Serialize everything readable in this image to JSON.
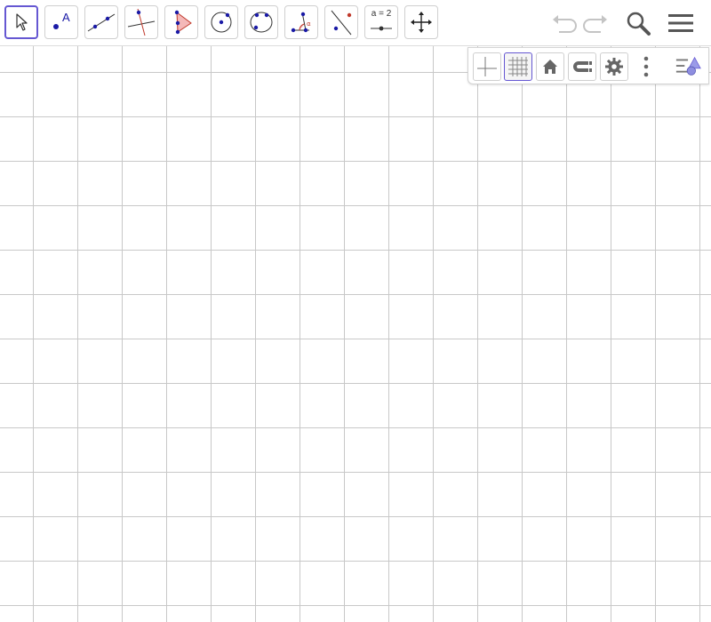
{
  "toolbar": {
    "tools": [
      {
        "name": "move-tool",
        "active": true
      },
      {
        "name": "point-tool"
      },
      {
        "name": "line-tool"
      },
      {
        "name": "perpendicular-line-tool"
      },
      {
        "name": "polygon-tool"
      },
      {
        "name": "circle-center-point-tool"
      },
      {
        "name": "circle-three-points-tool"
      },
      {
        "name": "angle-tool"
      },
      {
        "name": "reflect-about-line-tool"
      },
      {
        "name": "slider-tool",
        "label": "a = 2"
      },
      {
        "name": "move-graphics-view-tool"
      }
    ],
    "undo_icon": "undo-icon",
    "redo_icon": "redo-icon",
    "search_icon": "search-icon",
    "menu_icon": "menu-icon"
  },
  "style_bar": {
    "buttons": [
      {
        "name": "axes-toggle",
        "selected": false
      },
      {
        "name": "grid-toggle",
        "selected": true
      },
      {
        "name": "standard-view",
        "icon": "home-icon"
      },
      {
        "name": "point-capturing",
        "icon": "magnet-icon"
      },
      {
        "name": "graphics-settings",
        "icon": "gear-icon"
      },
      {
        "name": "more-options",
        "icon": "more-vertical-icon"
      },
      {
        "name": "algebra-view-toggle",
        "icon": "algebra-icon"
      }
    ]
  },
  "colors": {
    "accent": "#6557d2",
    "point": "#1a1aa6",
    "polygon_fill": "#f4b8b8",
    "grid_line": "#c8c8c8",
    "icon_gray": "#666666"
  }
}
